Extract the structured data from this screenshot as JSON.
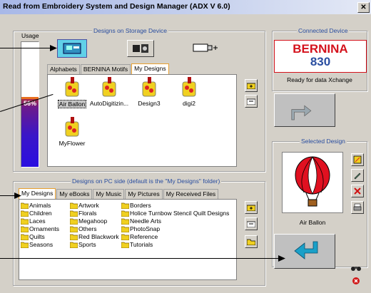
{
  "window": {
    "title": "Read from Embroidery System and Design Manager  (ADX V 6.0)",
    "close_glyph": "✕"
  },
  "storage": {
    "group_title": "Designs on Storage Device",
    "usage_label": "Usage",
    "usage_percent_text": "56%",
    "usage_fraction": 0.56,
    "tabs": [
      "Alphabets",
      "BERNINA Motifs",
      "My Designs"
    ],
    "active_tab": 2,
    "designs": [
      {
        "name": "Air Ballon",
        "selected": true
      },
      {
        "name": "AutoDigitizin..."
      },
      {
        "name": "Design3"
      },
      {
        "name": "digi2"
      },
      {
        "name": "MyFlower"
      }
    ]
  },
  "device": {
    "group_title": "Connected Device",
    "brand": "BERNINA",
    "model": "830",
    "status": "Ready for data Xchange"
  },
  "selected_design": {
    "group_title": "Selected Design",
    "name": "Air Ballon"
  },
  "pc": {
    "group_title": "Designs on PC side (default is the \"My Designs\" folder)",
    "tabs": [
      "My Designs",
      "My eBooks",
      "My Music",
      "My Pictures",
      "My Received Files"
    ],
    "active_tab": 0,
    "folders_col1": [
      "Animals",
      "Children",
      "Laces",
      "Ornaments",
      "Quilts",
      "Seasons"
    ],
    "folders_col2": [
      "Artwork",
      "Florals",
      "Megahoop",
      "Others",
      "Red Blackwork",
      "Sports"
    ],
    "folders_col3": [
      "Borders",
      "Holice Turnbow Stencil Quilt Designs",
      "Needle Arts",
      "PhotoSnap",
      "Reference",
      "Tutorials"
    ]
  },
  "colors": {
    "accent_blue": "#2a4ea0",
    "bernina_red": "#d4121c",
    "tab_highlight": "#e8a030",
    "transfer_arrow": "#1aa0c8"
  }
}
